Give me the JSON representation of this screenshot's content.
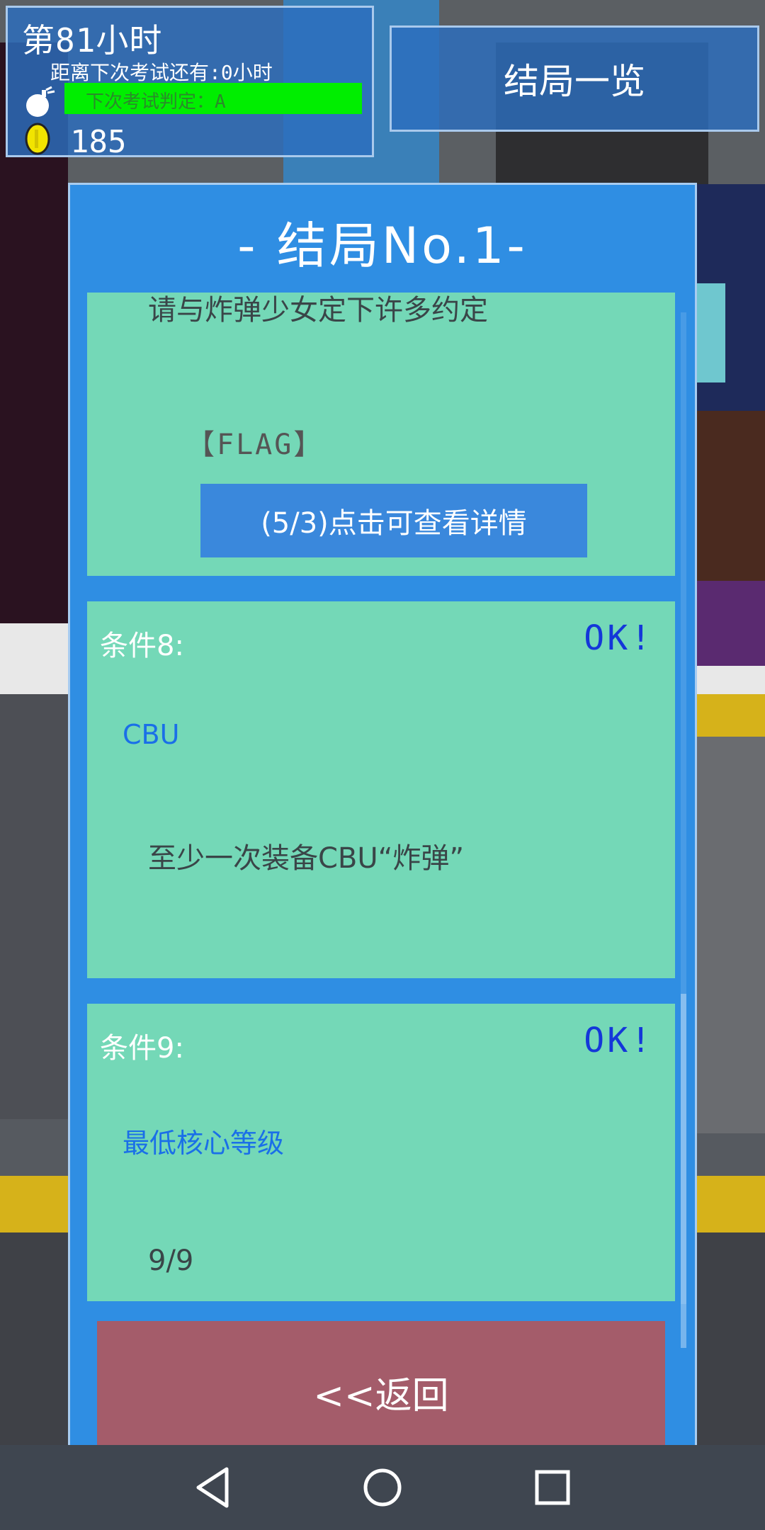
{
  "hud": {
    "hour_label": "第81小时",
    "exam_countdown": "距离下次考试还有:0小时",
    "judgement_text": "下次考试判定：A",
    "coin_count": "185",
    "icons": {
      "bomb": "bomb-icon",
      "coin": "coin-icon"
    }
  },
  "header_button": {
    "label": "结局一览"
  },
  "panel": {
    "title": "- 结局No.1-",
    "top_card": {
      "description": "请与炸弹少女定下许多约定",
      "flag_label": "【FLAG】",
      "detail_button": "(5/3)点击可查看详情"
    },
    "conditions": [
      {
        "label": "条件8:",
        "status": "OK!",
        "name": "CBU",
        "description": "至少一次装备CBU“炸弹”"
      },
      {
        "label": "条件9:",
        "status": "OK!",
        "name": "最低核心等级",
        "description": "9/9"
      }
    ],
    "back_button": "<<返回"
  },
  "navbar": {
    "icons": [
      "back-triangle-icon",
      "home-circle-icon",
      "recents-square-icon"
    ]
  },
  "colors": {
    "panel": "#2f8ee3",
    "card": "#74d8b7",
    "ok": "#1437d9",
    "back_button": "#a45c6a",
    "judge_bar": "#00ee00"
  }
}
